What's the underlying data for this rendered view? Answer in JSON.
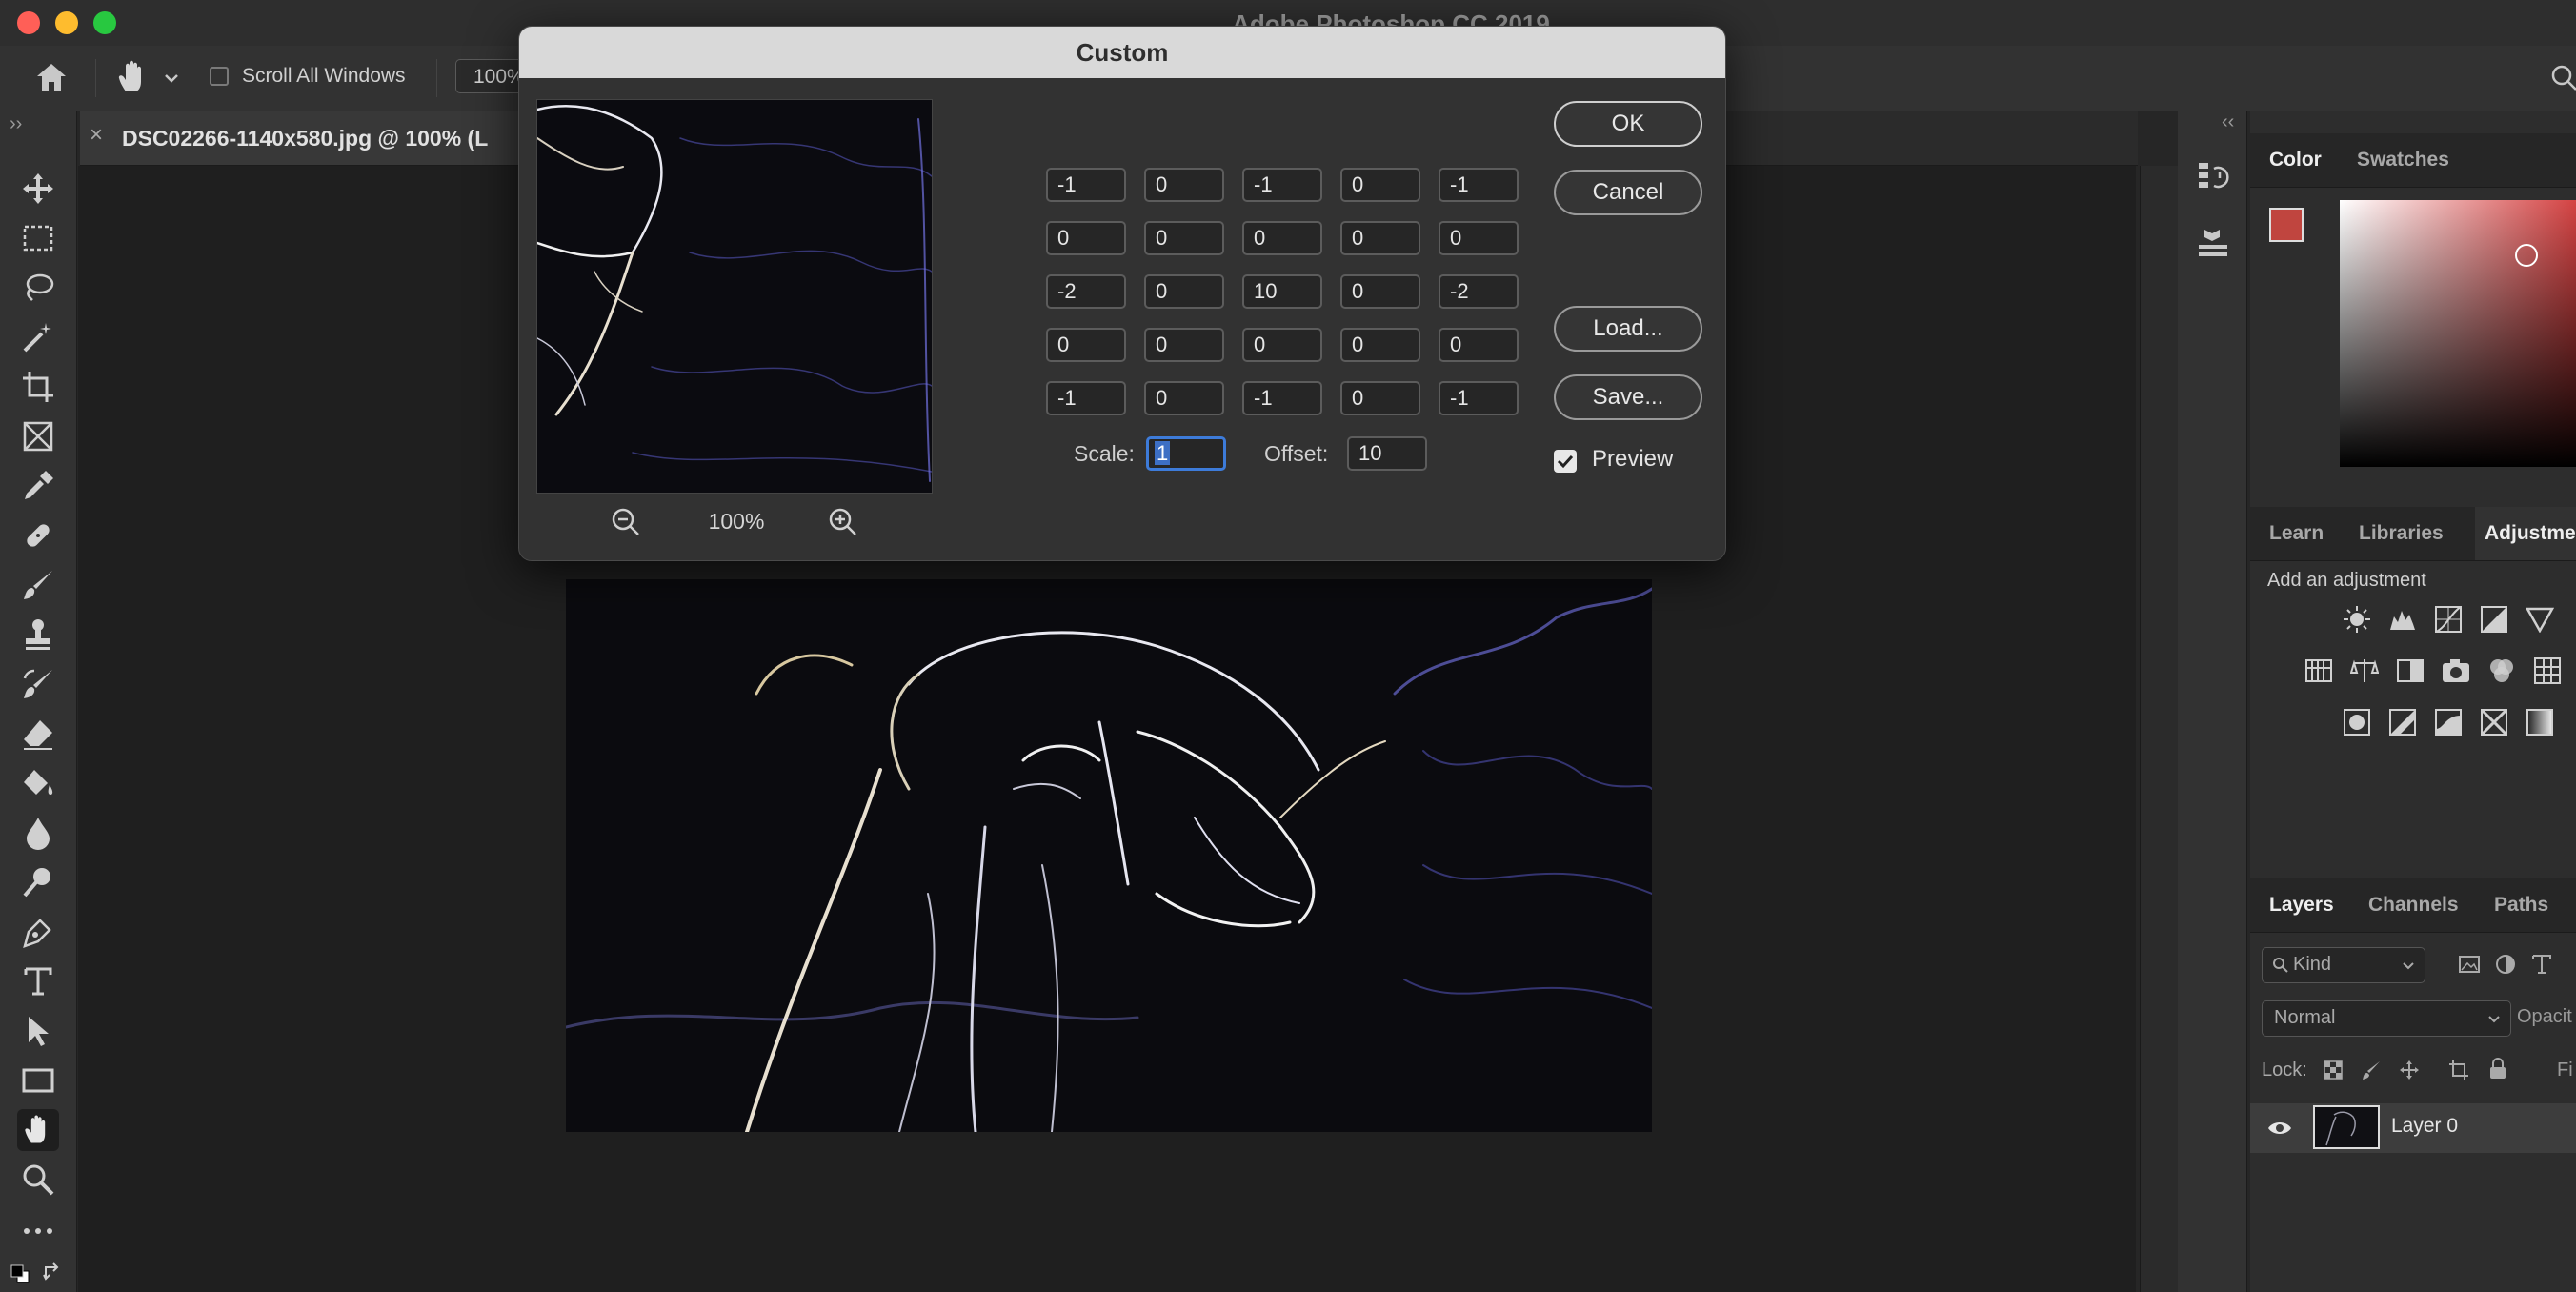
{
  "window": {
    "title": "Adobe Photoshop CC 2019"
  },
  "options_bar": {
    "scroll_all_windows": "Scroll All Windows",
    "zoom": "100%"
  },
  "document": {
    "tab_label": "DSC02266-1140x580.jpg @ 100% (L",
    "close_glyph": "×"
  },
  "dialog": {
    "title": "Custom",
    "preview_zoom": "100%",
    "matrix": [
      [
        "-1",
        "0",
        "-1",
        "0",
        "-1"
      ],
      [
        "0",
        "0",
        "0",
        "0",
        "0"
      ],
      [
        "-2",
        "0",
        "10",
        "0",
        "-2"
      ],
      [
        "0",
        "0",
        "0",
        "0",
        "0"
      ],
      [
        "-1",
        "0",
        "-1",
        "0",
        "-1"
      ]
    ],
    "scale_label": "Scale:",
    "scale_value": "1",
    "offset_label": "Offset:",
    "offset_value": "10",
    "buttons": {
      "ok": "OK",
      "cancel": "Cancel",
      "load": "Load...",
      "save": "Save..."
    },
    "preview_label": "Preview",
    "preview_checked": true
  },
  "panels": {
    "color_tabs": [
      "Color",
      "Swatches"
    ],
    "foreground_color": "#c0453f",
    "learn_tabs": [
      "Learn",
      "Libraries",
      "Adjustme"
    ],
    "add_adjustment": "Add an adjustment",
    "layers_tabs": [
      "Layers",
      "Channels",
      "Paths"
    ],
    "kind_filter": "Kind",
    "blend_mode": "Normal",
    "opacity_label": "Opacit",
    "lock_label": "Lock:",
    "fill_label": "Fi",
    "layer_name": "Layer 0"
  },
  "colors": {
    "accent": "#3d7bd9",
    "close": "#ff5f57",
    "minimize": "#febc2e",
    "zoom": "#28c840"
  }
}
